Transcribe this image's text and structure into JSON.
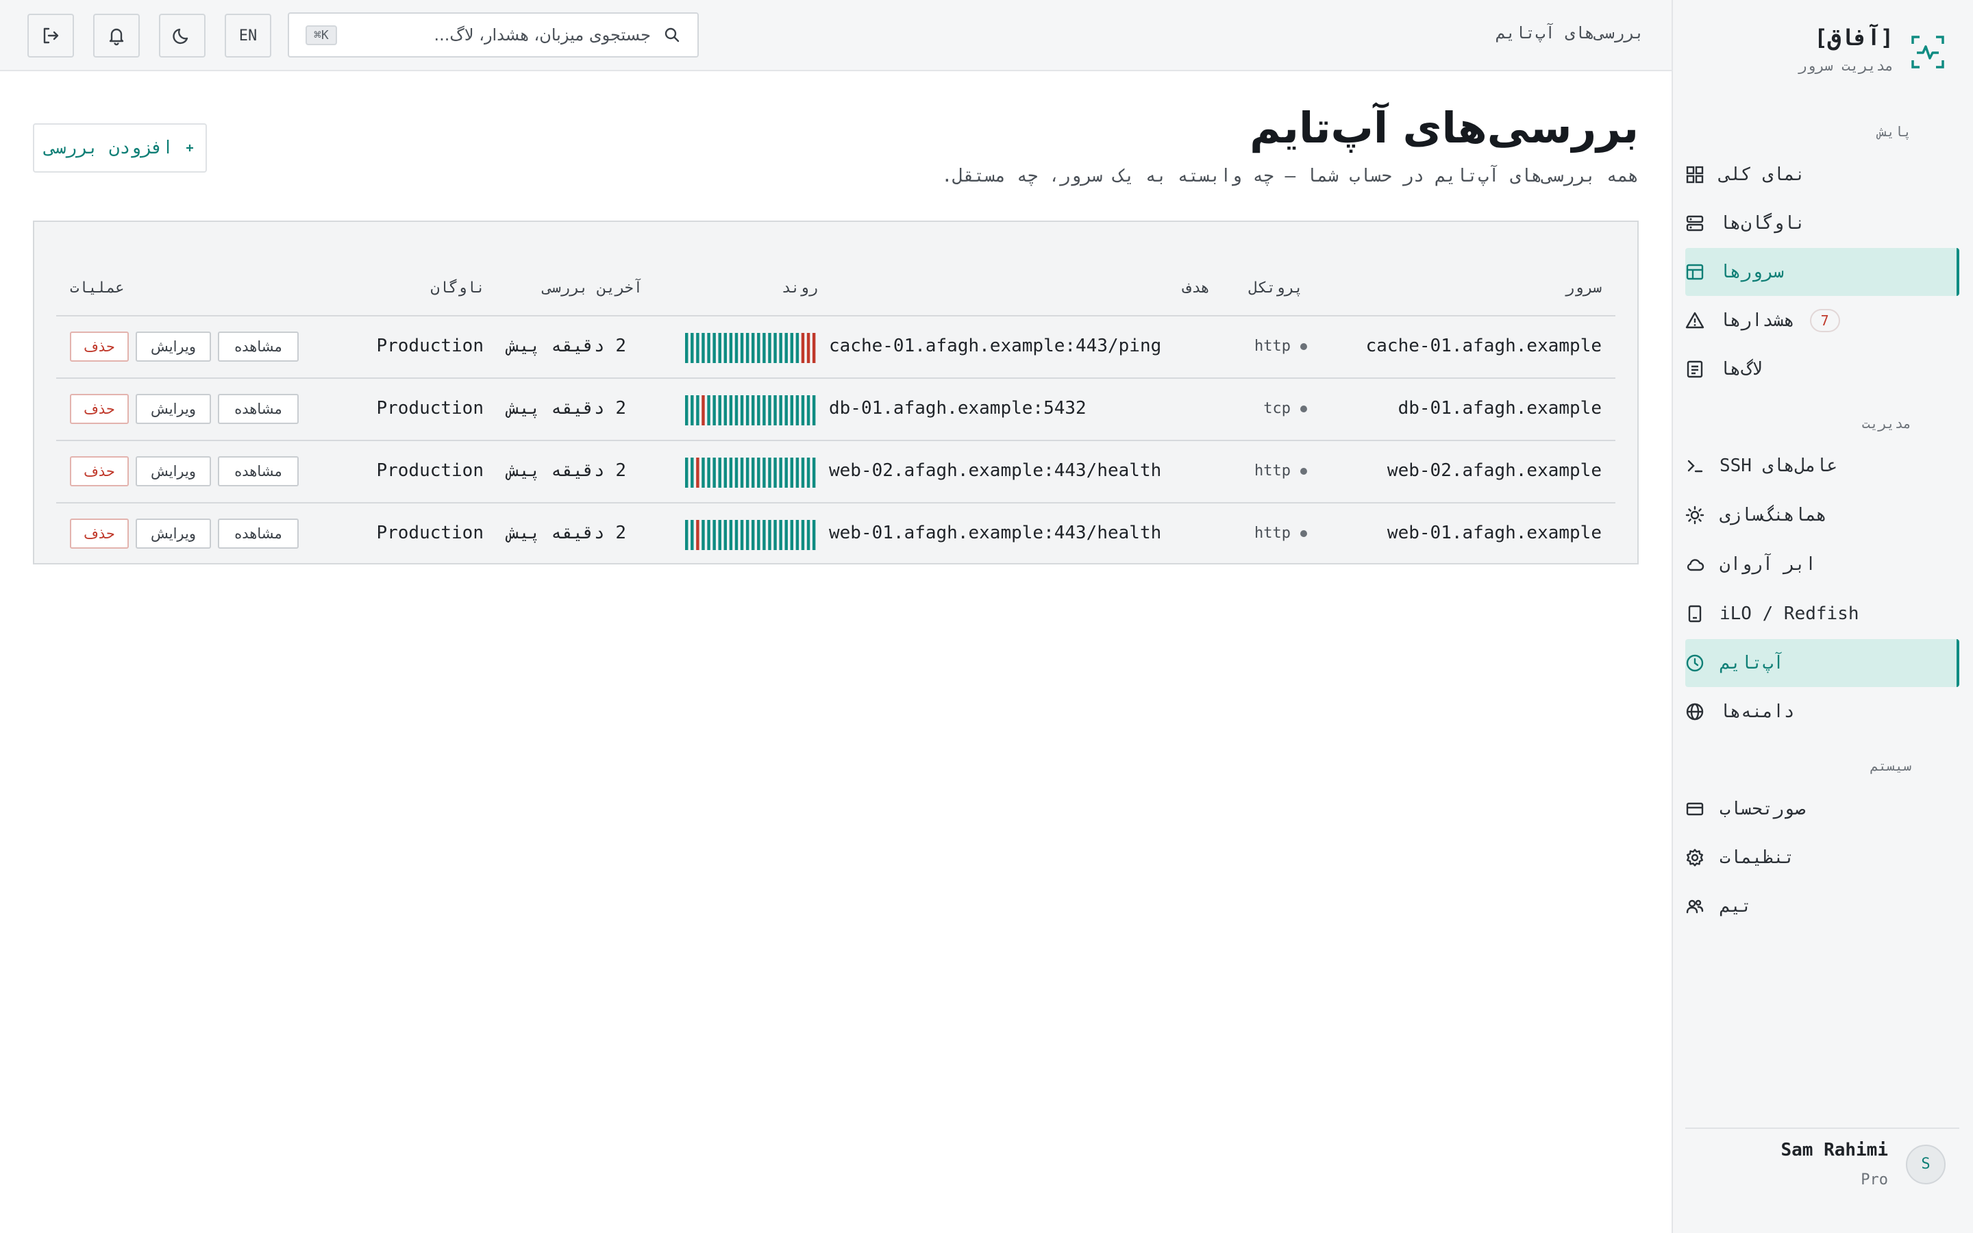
{
  "app": {
    "brand_name": "[آفاق]",
    "brand_subtitle": "مدیریت سرور"
  },
  "topbar": {
    "breadcrumb": "بررسی‌های آپ‌تایم",
    "search_placeholder": "جستجوی میزبان، هشدار، لاگ...",
    "search_shortcut": "⌘K",
    "lang_label": "EN"
  },
  "sidebar": {
    "sections": [
      {
        "title": "پایش",
        "items": [
          {
            "label": "نمای کلی",
            "icon": "grid-icon"
          },
          {
            "label": "ناوگان‌ها",
            "icon": "server-icon"
          },
          {
            "label": "سرورها",
            "icon": "table-icon",
            "active": true
          },
          {
            "label": "هشدارها",
            "icon": "warning-icon",
            "badge": "7"
          },
          {
            "label": "لاگ‌ها",
            "icon": "document-icon"
          }
        ]
      },
      {
        "title": "مدیریت",
        "items": [
          {
            "label": "عامل‌های SSH",
            "icon": "terminal-icon"
          },
          {
            "label": "هماهنگ‌سازی",
            "icon": "sync-icon"
          },
          {
            "label": "ابر آروان",
            "icon": "cloud-icon"
          },
          {
            "label": "iLO / Redfish",
            "icon": "device-icon"
          },
          {
            "label": "آپ‌تایم",
            "icon": "clock-icon",
            "active": true
          },
          {
            "label": "دامنه‌ها",
            "icon": "globe-icon"
          }
        ]
      },
      {
        "title": "سیستم",
        "items": [
          {
            "label": "صورتحساب",
            "icon": "card-icon"
          },
          {
            "label": "تنظیمات",
            "icon": "gear-icon"
          },
          {
            "label": "تیم",
            "icon": "users-icon"
          }
        ]
      }
    ],
    "user": {
      "initial": "S",
      "name": "Sam Rahimi",
      "plan": "Pro"
    }
  },
  "page": {
    "title": "بررسی‌های آپ‌تایم",
    "subtitle": "همه بررسی‌های آپ‌تایم در حساب شما — چه وابسته به یک سرور، چه مستقل.",
    "add_button": "افزودن بررسی",
    "add_button_icon": "plus-icon"
  },
  "table": {
    "headers": {
      "server": "سرور",
      "protocol": "پروتکل",
      "target": "هدف",
      "trend": "روند",
      "last_check": "آخرین بررسی",
      "fleet": "ناوگان",
      "actions": "عملیات"
    },
    "action_labels": {
      "view": "مشاهده",
      "edit": "ویرایش",
      "delete": "حذف"
    },
    "colors": {
      "up": "#0f8c82",
      "down": "#c0392b"
    },
    "rows": [
      {
        "server": "cache-01.afagh.example",
        "protocol": "http",
        "target": "cache-01.afagh.example:443/ping",
        "trend": [
          "up",
          "up",
          "up",
          "up",
          "up",
          "up",
          "up",
          "up",
          "up",
          "up",
          "up",
          "up",
          "up",
          "up",
          "up",
          "up",
          "up",
          "up",
          "up",
          "up",
          "up",
          "down",
          "down",
          "down"
        ],
        "last_check": "2 دقیقه پیش",
        "fleet": "Production"
      },
      {
        "server": "db-01.afagh.example",
        "protocol": "tcp",
        "target": "db-01.afagh.example:5432",
        "trend": [
          "up",
          "up",
          "up",
          "down",
          "up",
          "up",
          "up",
          "up",
          "up",
          "up",
          "up",
          "up",
          "up",
          "up",
          "up",
          "up",
          "up",
          "up",
          "up",
          "up",
          "up",
          "up",
          "up",
          "up"
        ],
        "last_check": "2 دقیقه پیش",
        "fleet": "Production"
      },
      {
        "server": "web-02.afagh.example",
        "protocol": "http",
        "target": "web-02.afagh.example:443/health",
        "trend": [
          "up",
          "up",
          "down",
          "up",
          "up",
          "up",
          "up",
          "up",
          "up",
          "up",
          "up",
          "up",
          "up",
          "up",
          "up",
          "up",
          "up",
          "up",
          "up",
          "up",
          "up",
          "up",
          "up",
          "up"
        ],
        "last_check": "2 دقیقه پیش",
        "fleet": "Production"
      },
      {
        "server": "web-01.afagh.example",
        "protocol": "http",
        "target": "web-01.afagh.example:443/health",
        "trend": [
          "up",
          "up",
          "down",
          "up",
          "up",
          "up",
          "up",
          "up",
          "up",
          "up",
          "up",
          "up",
          "up",
          "up",
          "up",
          "up",
          "up",
          "up",
          "up",
          "up",
          "up",
          "up",
          "up",
          "up"
        ],
        "last_check": "2 دقیقه پیش",
        "fleet": "Production"
      }
    ]
  }
}
